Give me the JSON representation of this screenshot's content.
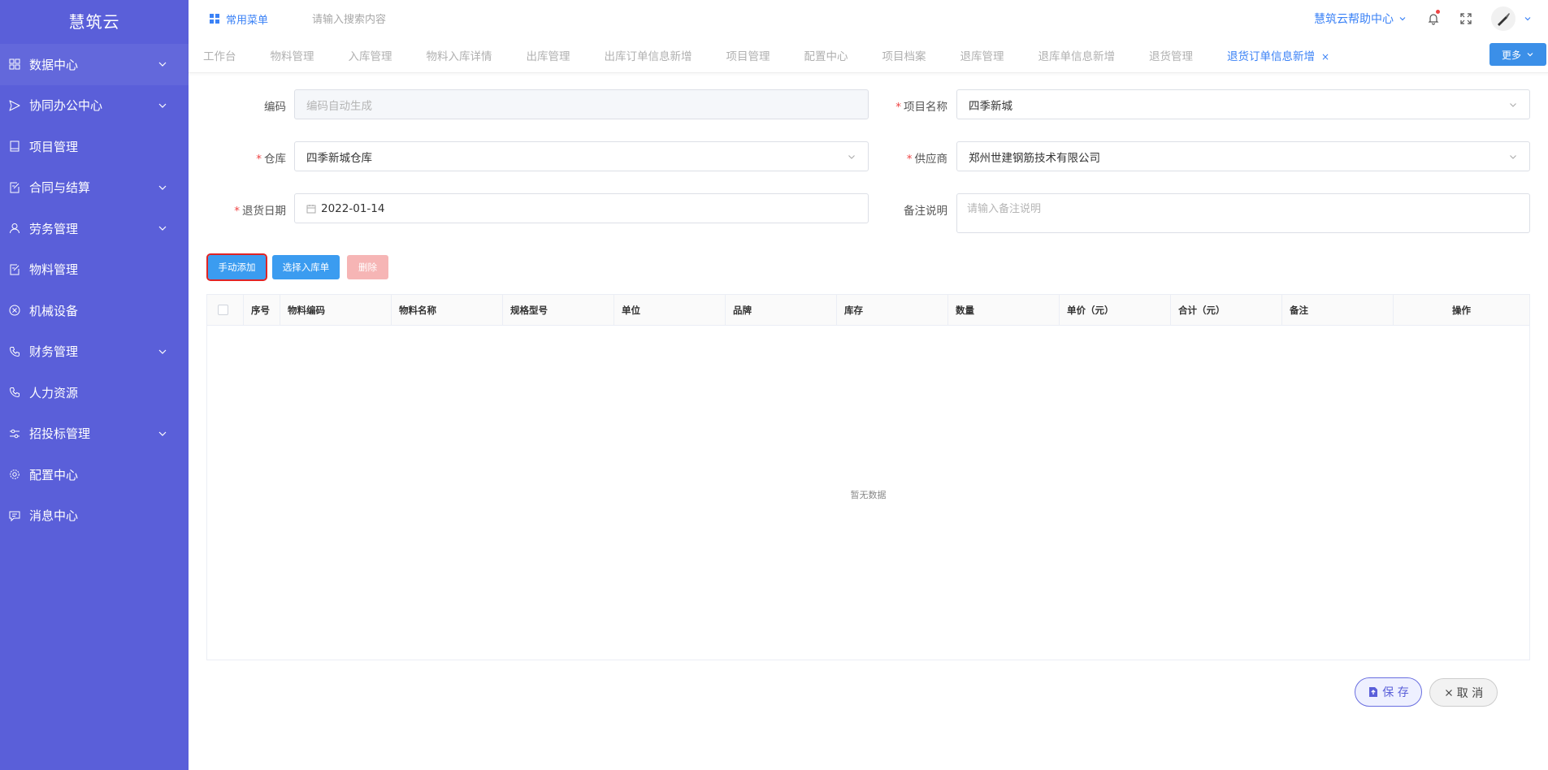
{
  "app": {
    "brand": "慧筑云"
  },
  "sidebar": {
    "items": [
      {
        "label": "数据中心",
        "icon": "grid-icon",
        "has_children": true
      },
      {
        "label": "协同办公中心",
        "icon": "send-icon",
        "has_children": true
      },
      {
        "label": "项目管理",
        "icon": "book-icon",
        "has_children": false
      },
      {
        "label": "合同与结算",
        "icon": "edit-doc-icon",
        "has_children": true
      },
      {
        "label": "劳务管理",
        "icon": "user-icon",
        "has_children": true
      },
      {
        "label": "物料管理",
        "icon": "edit-doc-icon",
        "has_children": false
      },
      {
        "label": "机械设备",
        "icon": "circle-x-icon",
        "has_children": false
      },
      {
        "label": "财务管理",
        "icon": "phone-icon",
        "has_children": true
      },
      {
        "label": "人力资源",
        "icon": "phone-icon",
        "has_children": false
      },
      {
        "label": "招投标管理",
        "icon": "sliders-icon",
        "has_children": true
      },
      {
        "label": "配置中心",
        "icon": "gear-icon",
        "has_children": false
      },
      {
        "label": "消息中心",
        "icon": "message-icon",
        "has_children": false
      }
    ]
  },
  "header": {
    "common_menu": "常用菜单",
    "search_placeholder": "请输入搜索内容",
    "help_center": "慧筑云帮助中心"
  },
  "tabs": {
    "items": [
      "工作台",
      "物料管理",
      "入库管理",
      "物料入库详情",
      "出库管理",
      "出库订单信息新增",
      "项目管理",
      "配置中心",
      "项目档案",
      "退库管理",
      "退库单信息新增",
      "退货管理"
    ],
    "active": "退货订单信息新增",
    "close_glyph": "×",
    "more": "更多"
  },
  "form": {
    "code_label": "编码",
    "code_placeholder": "编码自动生成",
    "project_label": "项目名称",
    "project_value": "四季新城",
    "warehouse_label": "仓库",
    "warehouse_value": "四季新城仓库",
    "supplier_label": "供应商",
    "supplier_value": "郑州世建钢筋技术有限公司",
    "date_label": "退货日期",
    "date_value": "2022-01-14",
    "remark_label": "备注说明",
    "remark_placeholder": "请输入备注说明",
    "required_mark": "*"
  },
  "actions": {
    "manual_add": "手动添加",
    "select_inbound": "选择入库单",
    "delete": "删除"
  },
  "table": {
    "columns": [
      "序号",
      "物料编码",
      "物料名称",
      "规格型号",
      "单位",
      "品牌",
      "库存",
      "数量",
      "单价（元）",
      "合计（元）",
      "备注",
      "操作"
    ],
    "empty_text": "暂无数据"
  },
  "footer": {
    "save": "保 存",
    "cancel": "取 消"
  },
  "colors": {
    "sidebar_bg": "#5a5fd9",
    "primary": "#3b9cf0",
    "link": "#3b82f6",
    "danger_light": "#f6b5b5",
    "highlight": "#e02424"
  }
}
